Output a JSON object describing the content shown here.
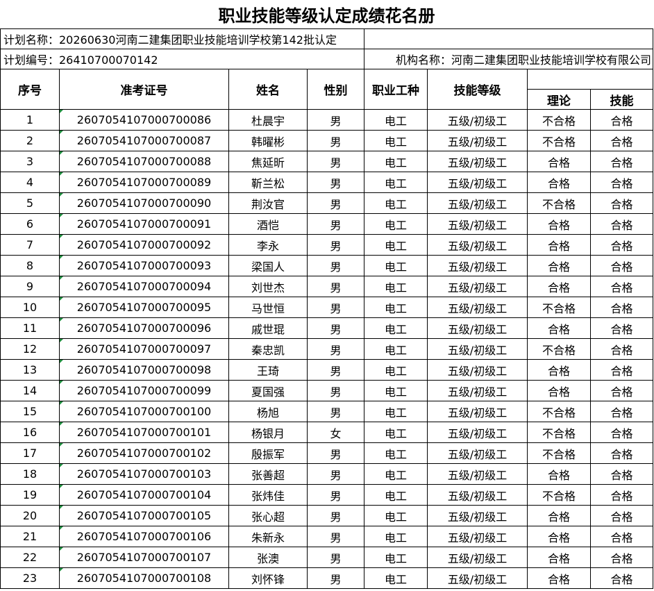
{
  "title": "职业技能等级认定成绩花名册",
  "plan_name": "计划名称：20260630河南二建集团职业技能培训学校第142批认定",
  "plan_number": "计划编号：26410700070142",
  "org_name": "机构名称：河南二建集团职业技能培训学校有限公司",
  "headers": {
    "seq": "序号",
    "exam_id": "准考证号",
    "name": "姓名",
    "gender": "性别",
    "occupation": "职业工种",
    "level": "技能等级",
    "theory": "理论",
    "skill": "技能"
  },
  "rows": [
    {
      "seq": "1",
      "exam_id": "2607054107000700086",
      "name": "杜晨宇",
      "gender": "男",
      "occupation": "电工",
      "level": "五级/初级工",
      "theory": "不合格",
      "skill": "合格"
    },
    {
      "seq": "2",
      "exam_id": "2607054107000700087",
      "name": "韩曜彬",
      "gender": "男",
      "occupation": "电工",
      "level": "五级/初级工",
      "theory": "不合格",
      "skill": "合格"
    },
    {
      "seq": "3",
      "exam_id": "2607054107000700088",
      "name": "焦延昕",
      "gender": "男",
      "occupation": "电工",
      "level": "五级/初级工",
      "theory": "合格",
      "skill": "合格"
    },
    {
      "seq": "4",
      "exam_id": "2607054107000700089",
      "name": "靳兰松",
      "gender": "男",
      "occupation": "电工",
      "level": "五级/初级工",
      "theory": "合格",
      "skill": "合格"
    },
    {
      "seq": "5",
      "exam_id": "2607054107000700090",
      "name": "荆汝官",
      "gender": "男",
      "occupation": "电工",
      "level": "五级/初级工",
      "theory": "不合格",
      "skill": "合格"
    },
    {
      "seq": "6",
      "exam_id": "2607054107000700091",
      "name": "酒恺",
      "gender": "男",
      "occupation": "电工",
      "level": "五级/初级工",
      "theory": "合格",
      "skill": "合格"
    },
    {
      "seq": "7",
      "exam_id": "2607054107000700092",
      "name": "李永",
      "gender": "男",
      "occupation": "电工",
      "level": "五级/初级工",
      "theory": "合格",
      "skill": "合格"
    },
    {
      "seq": "8",
      "exam_id": "2607054107000700093",
      "name": "梁国人",
      "gender": "男",
      "occupation": "电工",
      "level": "五级/初级工",
      "theory": "合格",
      "skill": "合格"
    },
    {
      "seq": "9",
      "exam_id": "2607054107000700094",
      "name": "刘世杰",
      "gender": "男",
      "occupation": "电工",
      "level": "五级/初级工",
      "theory": "合格",
      "skill": "合格"
    },
    {
      "seq": "10",
      "exam_id": "2607054107000700095",
      "name": "马世恒",
      "gender": "男",
      "occupation": "电工",
      "level": "五级/初级工",
      "theory": "不合格",
      "skill": "合格"
    },
    {
      "seq": "11",
      "exam_id": "2607054107000700096",
      "name": "戚世琨",
      "gender": "男",
      "occupation": "电工",
      "level": "五级/初级工",
      "theory": "合格",
      "skill": "合格"
    },
    {
      "seq": "12",
      "exam_id": "2607054107000700097",
      "name": "秦忠凯",
      "gender": "男",
      "occupation": "电工",
      "level": "五级/初级工",
      "theory": "不合格",
      "skill": "合格"
    },
    {
      "seq": "13",
      "exam_id": "2607054107000700098",
      "name": "王琦",
      "gender": "男",
      "occupation": "电工",
      "level": "五级/初级工",
      "theory": "合格",
      "skill": "合格"
    },
    {
      "seq": "14",
      "exam_id": "2607054107000700099",
      "name": "夏国强",
      "gender": "男",
      "occupation": "电工",
      "level": "五级/初级工",
      "theory": "合格",
      "skill": "合格"
    },
    {
      "seq": "15",
      "exam_id": "2607054107000700100",
      "name": "杨旭",
      "gender": "男",
      "occupation": "电工",
      "level": "五级/初级工",
      "theory": "不合格",
      "skill": "合格"
    },
    {
      "seq": "16",
      "exam_id": "2607054107000700101",
      "name": "杨银月",
      "gender": "女",
      "occupation": "电工",
      "level": "五级/初级工",
      "theory": "不合格",
      "skill": "合格"
    },
    {
      "seq": "17",
      "exam_id": "2607054107000700102",
      "name": "殷振军",
      "gender": "男",
      "occupation": "电工",
      "level": "五级/初级工",
      "theory": "不合格",
      "skill": "合格"
    },
    {
      "seq": "18",
      "exam_id": "2607054107000700103",
      "name": "张善超",
      "gender": "男",
      "occupation": "电工",
      "level": "五级/初级工",
      "theory": "合格",
      "skill": "合格"
    },
    {
      "seq": "19",
      "exam_id": "2607054107000700104",
      "name": "张炜佳",
      "gender": "男",
      "occupation": "电工",
      "level": "五级/初级工",
      "theory": "不合格",
      "skill": "合格"
    },
    {
      "seq": "20",
      "exam_id": "2607054107000700105",
      "name": "张心超",
      "gender": "男",
      "occupation": "电工",
      "level": "五级/初级工",
      "theory": "合格",
      "skill": "合格"
    },
    {
      "seq": "21",
      "exam_id": "2607054107000700106",
      "name": "朱新永",
      "gender": "男",
      "occupation": "电工",
      "level": "五级/初级工",
      "theory": "合格",
      "skill": "合格"
    },
    {
      "seq": "22",
      "exam_id": "2607054107000700107",
      "name": "张澳",
      "gender": "男",
      "occupation": "电工",
      "level": "五级/初级工",
      "theory": "合格",
      "skill": "合格"
    },
    {
      "seq": "23",
      "exam_id": "2607054107000700108",
      "name": "刘怀锋",
      "gender": "男",
      "occupation": "电工",
      "level": "五级/初级工",
      "theory": "合格",
      "skill": "合格"
    }
  ]
}
